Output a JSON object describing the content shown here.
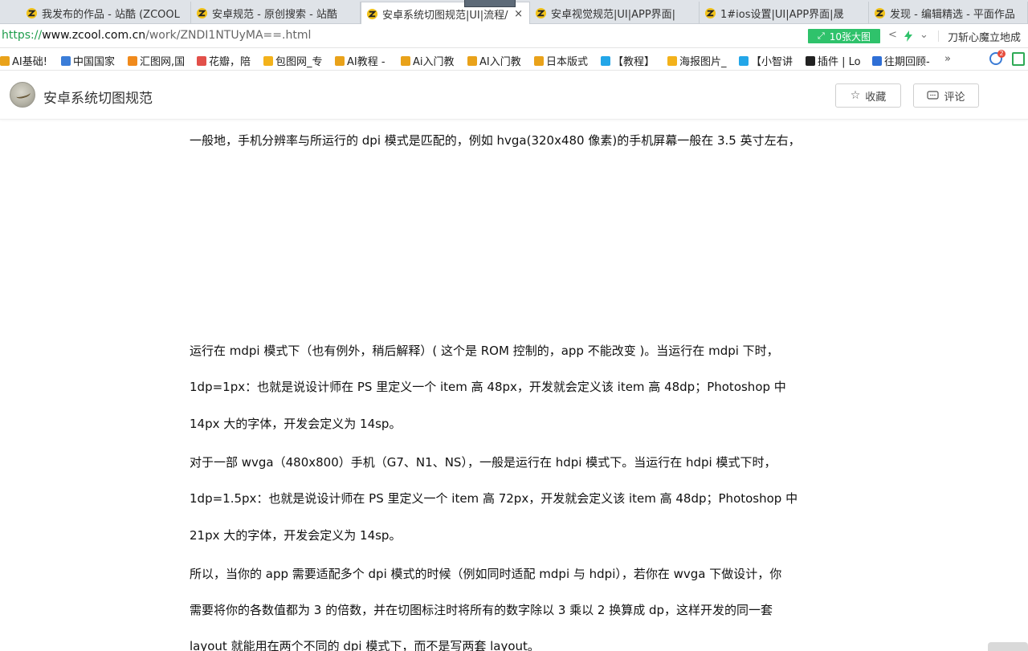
{
  "tabs": [
    {
      "title": "我发布的作品 - 站酷 (ZCOOL"
    },
    {
      "title": "安卓规范 - 原创搜索 - 站酷"
    },
    {
      "title": "安卓系统切图规范|UI|流程/",
      "close": "×"
    },
    {
      "title": "安卓视觉规范|UI|APP界面|"
    },
    {
      "title": "1#ios设置|UI|APP界面|晟"
    },
    {
      "title": "发现 - 编辑精选 - 平面作品"
    }
  ],
  "address": {
    "scheme": "https://",
    "host": "www.zcool.com.cn",
    "path": "/work/ZNDI1NTUyMA==.html",
    "big_image_button": "10张大图",
    "search_text": "刀斩心魔立地成"
  },
  "bookmarks": [
    {
      "label": "AI基础!",
      "color": "#e9a21a"
    },
    {
      "label": "中国国家",
      "color": "#3b7dd8"
    },
    {
      "label": "汇图网,国",
      "color": "#f08a1c"
    },
    {
      "label": "花瓣，陪",
      "color": "#e2504a"
    },
    {
      "label": "包图网_专",
      "color": "#f3b21b"
    },
    {
      "label": "AI教程 -",
      "color": "#e9a21a"
    },
    {
      "label": "Ai入门教",
      "color": "#e9a21a"
    },
    {
      "label": "AI入门教",
      "color": "#e9a21a"
    },
    {
      "label": "日本版式",
      "color": "#e9a21a"
    },
    {
      "label": "【教程】",
      "color": "#23a6e8"
    },
    {
      "label": "海报图片_",
      "color": "#f3b21b"
    },
    {
      "label": "【小智讲",
      "color": "#23a6e8"
    },
    {
      "label": "插件 | Lo",
      "color": "#222222"
    },
    {
      "label": "往期回顾-",
      "color": "#2f6fd6"
    }
  ],
  "bookmarks_more": "»",
  "notification_count": "2",
  "header": {
    "title": "安卓系统切图规范",
    "favorite_label": "收藏",
    "comment_label": "评论"
  },
  "article": {
    "paragraphs": [
      "一般地，手机分辨率与所运行的 dpi 模式是匹配的，例如 hvga(320x480 像素)的手机屏幕一般在 3.5 英寸左右，",
      "运行在 mdpi 模式下（也有例外，稍后解释）( 这个是 ROM 控制的，app 不能改变 )。当运行在 mdpi 下时，",
      "1dp=1px：也就是说设计师在 PS 里定义一个 item 高 48px，开发就会定义该 item 高 48dp；Photoshop 中",
      "14px 大的字体，开发会定义为 14sp。",
      "对于一部 wvga（480x800）手机（G7、N1、NS），一般是运行在 hdpi 模式下。当运行在 hdpi 模式下时，",
      "1dp=1.5px：也就是说设计师在 PS 里定义一个 item 高 72px，开发就会定义该 item 高 48dp；Photoshop 中",
      "21px 大的字体，开发会定义为 14sp。",
      "所以，当你的 app 需要适配多个 dpi 模式的时候（例如同时适配 mdpi 与 hdpi），若你在 wvga 下做设计，你",
      "需要将你的各数值都为 3 的倍数，并在切图标注时将所有的数字除以 3 乘以 2 换算成 dp，这样开发的同一套",
      "layout 就能用在两个不同的 dpi 模式下，而不是写两套 layout。"
    ]
  },
  "colors": {
    "accent_green": "#2fc26b",
    "tab_bar": "#dfe3e8",
    "text": "#111111"
  }
}
